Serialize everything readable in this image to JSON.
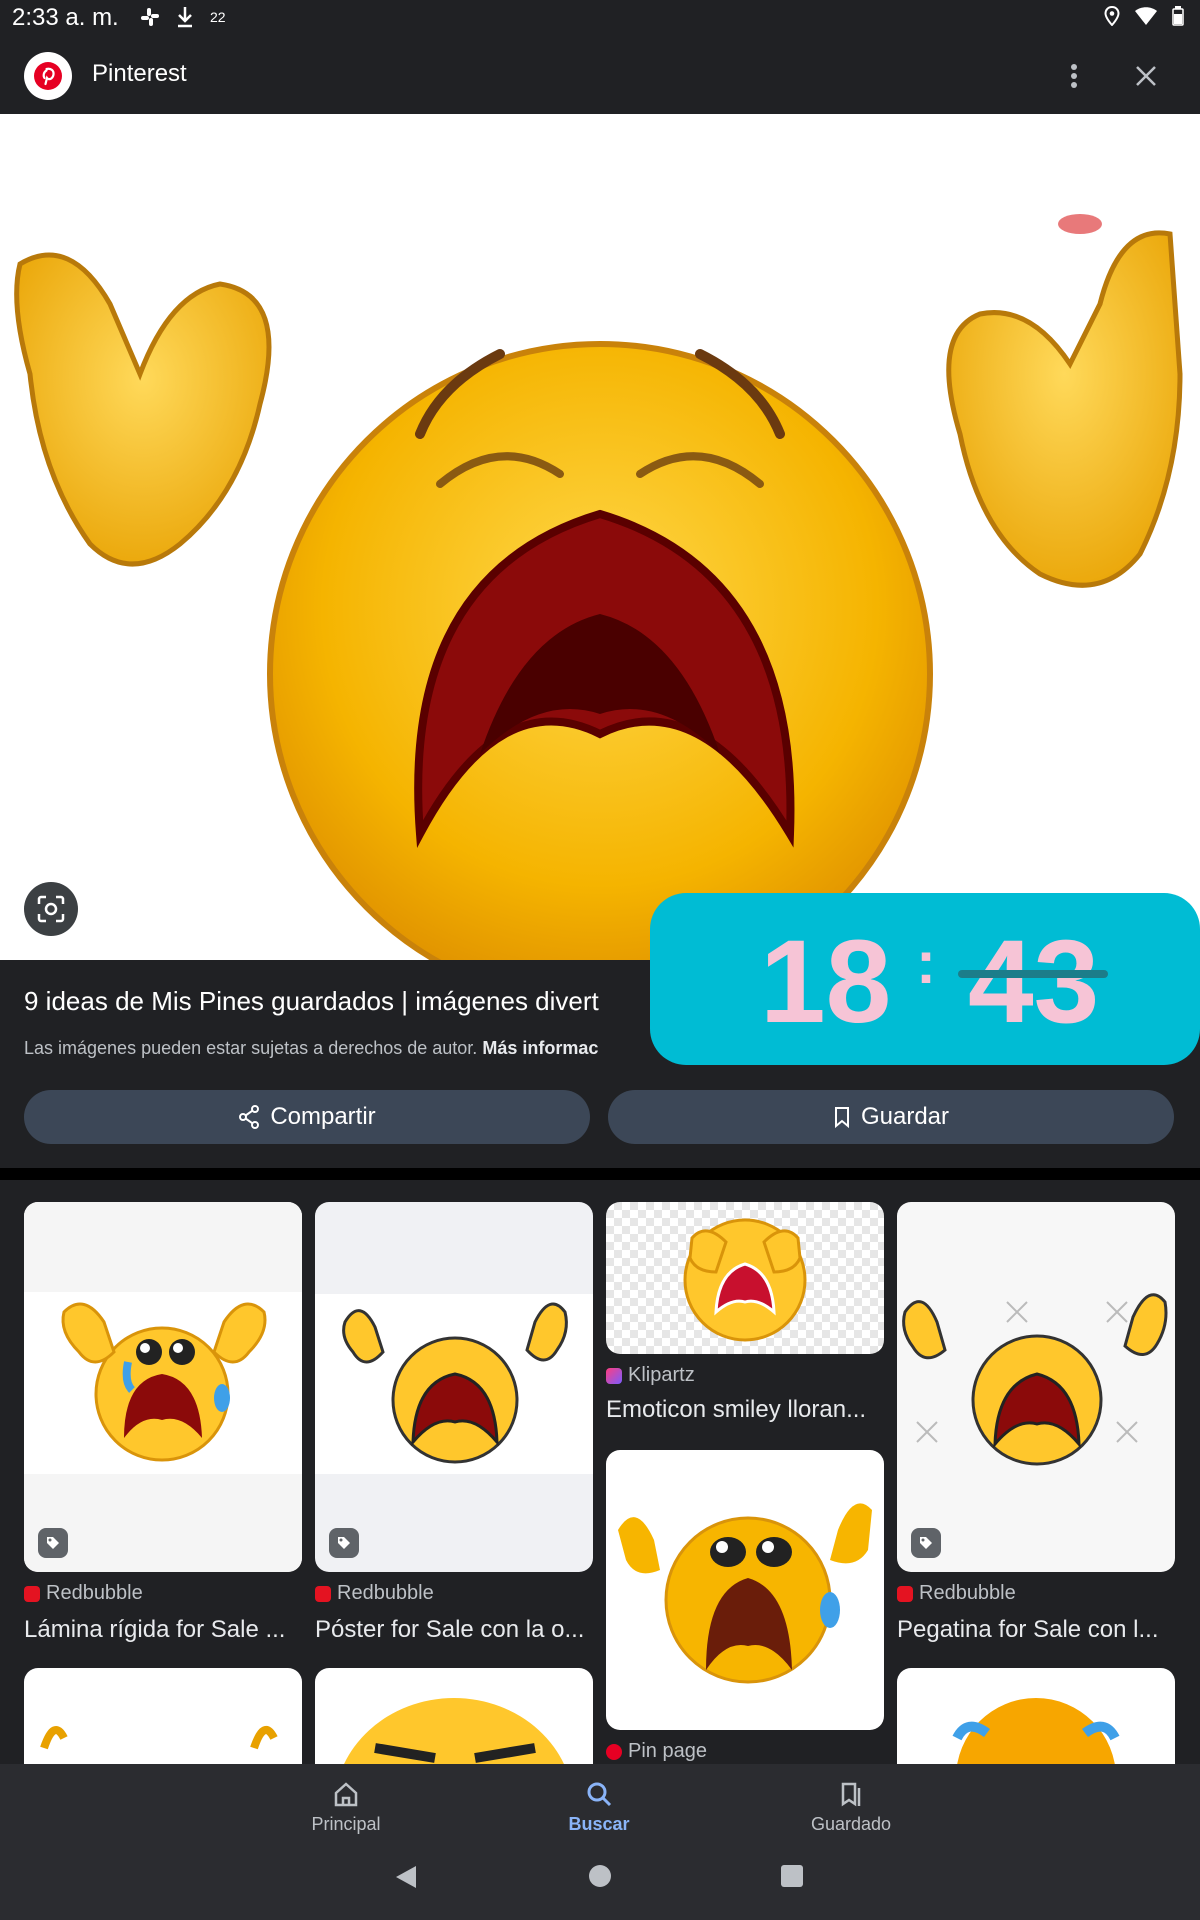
{
  "status_bar": {
    "time": "2:33 a. m.",
    "notif_count": "22"
  },
  "app_bar": {
    "title": "Pinterest"
  },
  "pin": {
    "title": "9 ideas de Mis Pines guardados | imágenes divert",
    "copyright_text": "Las imágenes pueden estar sujetas a derechos de autor.",
    "copyright_link": "Más informac",
    "share_label": "Compartir",
    "save_label": "Guardar"
  },
  "clock_overlay": {
    "hours": "18",
    "separator": ":",
    "minutes": "43"
  },
  "results": [
    {
      "source": "Redbubble",
      "caption": "Lámina rígida for Sale ..."
    },
    {
      "source": "Redbubble",
      "caption": "Póster for Sale con la o..."
    },
    {
      "source": "Klipartz",
      "caption": "Emoticon smiley lloran..."
    },
    {
      "source": "Pin page",
      "caption": ""
    },
    {
      "source": "Redbubble",
      "caption": "Pegatina for Sale con l..."
    }
  ],
  "bottom_nav": {
    "home": "Principal",
    "search": "Buscar",
    "saved": "Guardado"
  },
  "colors": {
    "background": "#202124",
    "accent": "#8ab4f8",
    "button": "#3c4757",
    "overlay": "#00bcd4",
    "overlay_text": "#f6c4d6"
  }
}
